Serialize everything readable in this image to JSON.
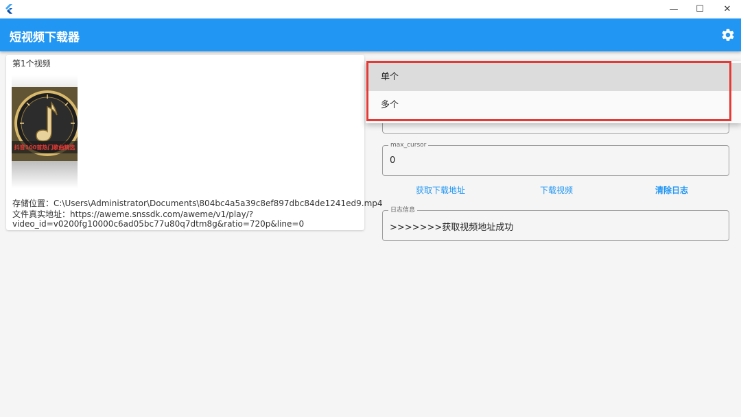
{
  "window": {
    "minimize_glyph": "—",
    "maximize_glyph": "☐",
    "close_glyph": "✕"
  },
  "appbar": {
    "title": "短视频下载器",
    "color": "#2196f3"
  },
  "video_card": {
    "title": "第1个视频",
    "thumbnail_caption": "抖音100首热门歌曲精选",
    "storage_line": "存储位置：C:\\Users\\Administrator\\Documents\\804bc4a5a39c8ef897dbc84de1241ed9.mp4",
    "url_line_1": "文件真实地址：https://aweme.snssdk.com/aweme/v1/play/?",
    "url_line_2": "video_id=v0200fg10000c6ad05bc77u80q7dtm8g&ratio=720p&line=0"
  },
  "form": {
    "max_cursor": {
      "label": "max_cursor",
      "value": "0"
    },
    "log": {
      "label": "日志信息",
      "value": ">>>>>>>获取视频地址成功"
    }
  },
  "actions": {
    "get_url": "获取下载地址",
    "download": "下载视频",
    "clear_log": "清除日志"
  },
  "dropdown": {
    "options": [
      "单个",
      "多个"
    ],
    "selected": "单个"
  },
  "colors": {
    "accent": "#2196f3",
    "highlight": "#e53935"
  }
}
